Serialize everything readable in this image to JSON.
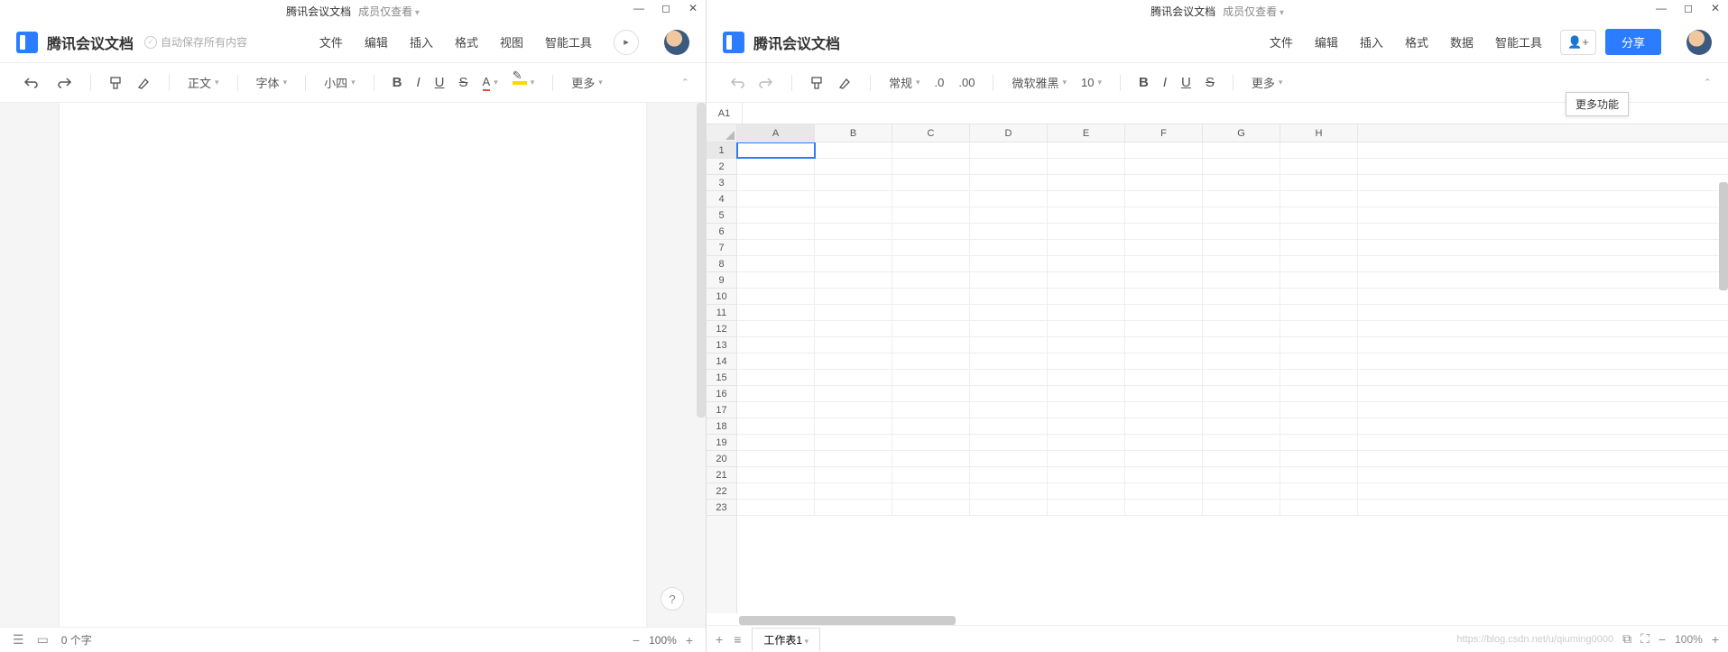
{
  "left": {
    "title": "腾讯会议文档",
    "permission": "成员仅查看",
    "app_name": "腾讯会议文档",
    "autosave": "自动保存所有内容",
    "menu": [
      "文件",
      "编辑",
      "插入",
      "格式",
      "视图",
      "智能工具"
    ],
    "toolbar": {
      "body_text": "正文",
      "font": "字体",
      "size": "小四",
      "more": "更多"
    },
    "status": {
      "word_count": "0 个字",
      "zoom": "100%"
    }
  },
  "right": {
    "title": "腾讯会议文档",
    "permission": "成员仅查看",
    "app_name": "腾讯会议文档",
    "menu": [
      "文件",
      "编辑",
      "插入",
      "格式",
      "数据",
      "智能工具"
    ],
    "share": "分享",
    "toolbar": {
      "format": "常规",
      "font": "微软雅黑",
      "size": "10",
      "more": "更多"
    },
    "tooltip": "更多功能",
    "namebox": "A1",
    "cols": [
      "A",
      "B",
      "C",
      "D",
      "E",
      "F",
      "G",
      "H"
    ],
    "rows": 23,
    "sheet_tab": "工作表1",
    "zoom": "100%",
    "watermark": "https://blog.csdn.net/u/qiuming0000"
  }
}
